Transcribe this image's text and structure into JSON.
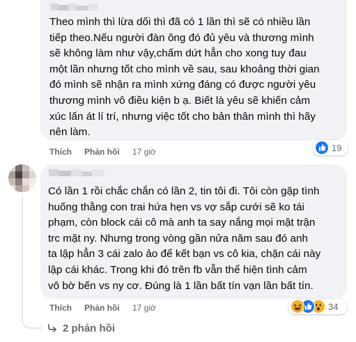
{
  "comments": [
    {
      "text": "Theo mình thì lừa dối thì đã có 1 lần thì sẽ có nhiều lần\ntiếp theo.Nếu người đàn ông đó đủ yêu và thương mình\nsẽ không làm như vậy,chấm dứt hẳn cho xong tuy đau\nmột lần nhưng tốt cho mình về sau, sau khoảng thời gian\nđó mình sẽ nhận ra mình xứng đáng có được người yêu\nthương mình vô điều kiện b ạ. Biết là yêu sẽ khiến cảm\nxúc lấn át lí trí, nhưng việc tốt cho bản thân mình thì hãy\nnên làm.",
      "like_label": "Thích",
      "reply_label": "Phản hồi",
      "time": "17 giờ",
      "reaction_count": "19",
      "reaction_icons": [
        "like-icon"
      ]
    },
    {
      "text": "Có lần 1 rồi chắc chắn có lần 2, tin tôi đi. Tôi còn gặp tình\nhuống thằng con trai hứa hẹn vs vợ sắp cưới sẽ ko tái\nphạm, còn block cái cô mà anh ta say nắng mọi mặt trận\ntrc mặt ny. Nhưng trong vòng gần nửa năm sau đó anh\nta lập hẳn 3 cái zalo ảo để kết bạn vs cô kia, chặn cái này\nlập cái khác. Trong khi đó trên fb vẫn thể hiện tình cảm\nvô bờ bến vs ny cơ. Đúng là 1 lần bất tín vạn lần bất tín.",
      "like_label": "Thích",
      "reply_label": "Phản hồi",
      "time": "17 giờ",
      "reaction_count": "34",
      "reaction_icons": [
        "haha-icon",
        "like-icon",
        "wow-icon"
      ]
    }
  ],
  "replies_link": "2 phản hồi",
  "colors": {
    "bubble": "#f0f2f5",
    "secondary_text": "#65676b",
    "like_blue": "#1877f2",
    "emoji_yellow": "#f7b125"
  }
}
